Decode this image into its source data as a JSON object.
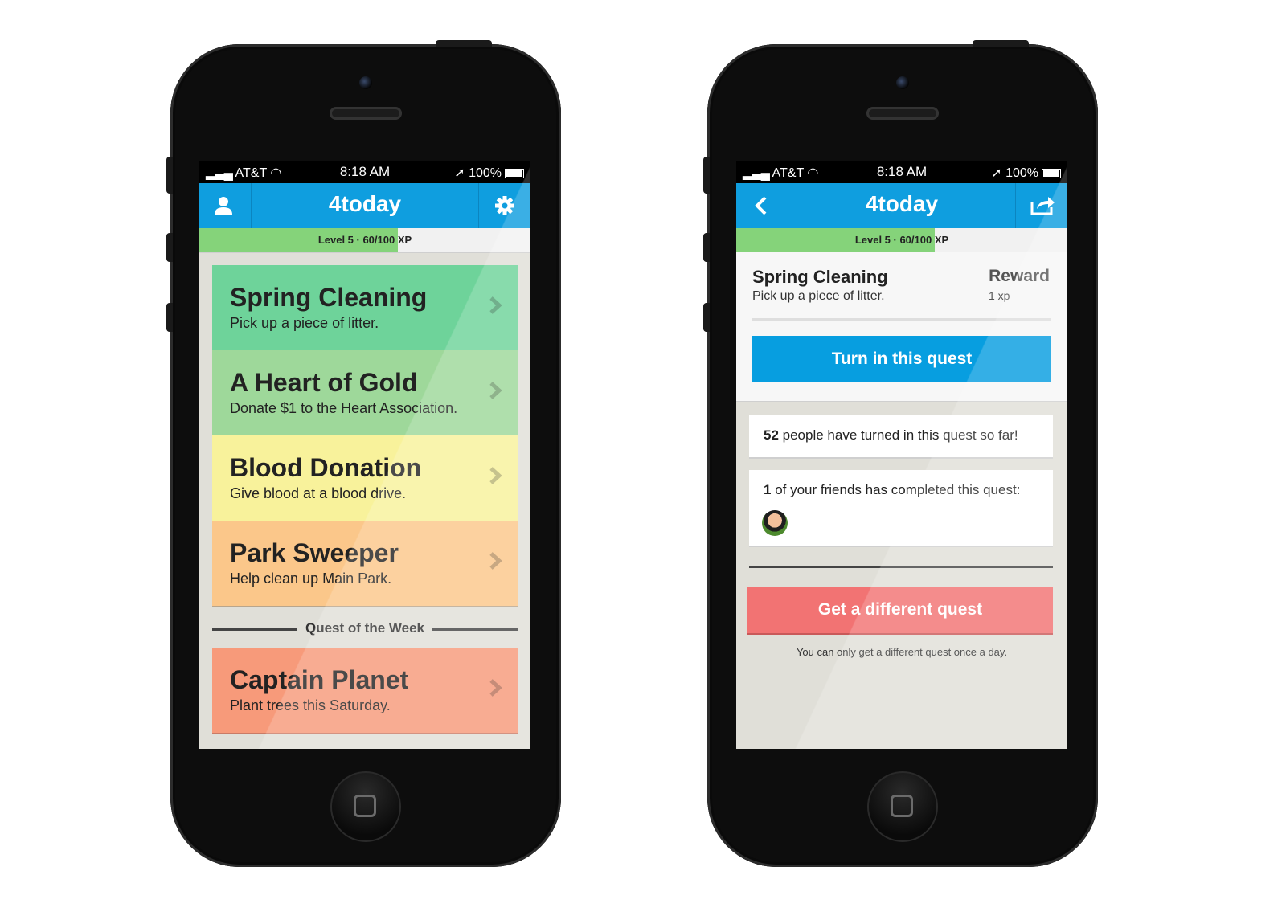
{
  "status": {
    "carrier": "AT&T",
    "time": "8:18 AM",
    "battery": "100%"
  },
  "app": {
    "title": "4today"
  },
  "xp": {
    "label": "Level 5 · 60/100 XP",
    "progress": 0.6
  },
  "quests": [
    {
      "title": "Spring Cleaning",
      "sub": "Pick up a piece of litter.",
      "color": "#6ed39a"
    },
    {
      "title": "A Heart of Gold",
      "sub": "Donate $1 to the Heart Association.",
      "color": "#9ed89a"
    },
    {
      "title": "Blood Donation",
      "sub": "Give blood at a blood drive.",
      "color": "#f8f29b"
    },
    {
      "title": "Park Sweeper",
      "sub": "Help clean up Main Park.",
      "color": "#fbc78a"
    }
  ],
  "week": {
    "label": "Quest of the Week",
    "quest": {
      "title": "Captain Planet",
      "sub": "Plant trees this Saturday.",
      "color": "#f79a7a"
    }
  },
  "detail": {
    "title": "Spring Cleaning",
    "sub": "Pick up a piece of litter.",
    "reward_label": "Reward",
    "reward_value": "1 xp",
    "turn_in": "Turn in this quest",
    "people_count": "52",
    "people_text": " people have turned in this quest so far!",
    "friends_count": "1",
    "friends_text": " of your friends has completed this quest:",
    "different": "Get a different quest",
    "note": "You can only get a different quest once a day."
  },
  "icons": {
    "profile": "user-icon",
    "settings": "gear-icon",
    "back": "back-chevron-icon",
    "share": "share-icon"
  }
}
